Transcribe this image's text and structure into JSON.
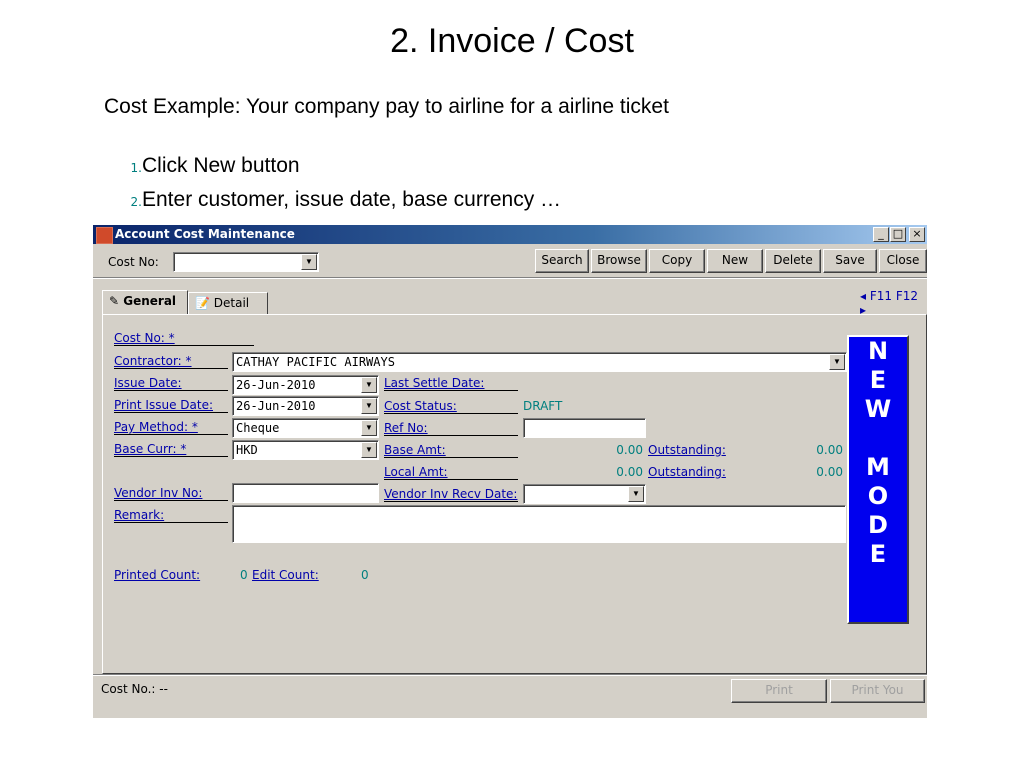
{
  "slide": {
    "title": "2. Invoice / Cost",
    "subtitle": "Cost Example: Your company pay to airline for a airline ticket",
    "steps": [
      {
        "num": "1.",
        "text": "Click New button"
      },
      {
        "num": "2.",
        "text": "Enter customer, issue date, base currency …"
      }
    ]
  },
  "window": {
    "title": "Account Cost Maintenance",
    "controls": {
      "minimize": "_",
      "maximize": "□",
      "close": "×"
    }
  },
  "toolbar": {
    "cost_no_label": "Cost No:",
    "cost_no_value": "",
    "buttons": {
      "search": "Search",
      "browse": "Browse",
      "copy": "Copy",
      "new": "New",
      "delete": "Delete",
      "save": "Save",
      "close": "Close"
    }
  },
  "tabs": {
    "general": "General",
    "detail": "Detail",
    "nav": "◂ F11 F12 ▸"
  },
  "form": {
    "cost_no_label": "Cost No: *",
    "contractor_label": "Contractor: *",
    "contractor_value": "CATHAY PACIFIC AIRWAYS",
    "issue_date_label": "Issue Date:",
    "issue_date_value": "26-Jun-2010",
    "last_settle_date_label": "Last Settle Date:",
    "print_issue_date_label": "Print Issue Date:",
    "print_issue_date_value": "26-Jun-2010",
    "cost_status_label": "Cost Status:",
    "cost_status_value": "DRAFT",
    "pay_method_label": "Pay Method: *",
    "pay_method_value": "Cheque",
    "ref_no_label": "Ref No:",
    "base_curr_label": "Base Curr: *",
    "base_curr_value": "HKD",
    "base_amt_label": "Base Amt:",
    "base_amt_value": "0.00",
    "outstanding_label": "Outstanding:",
    "base_outstanding_value": "0.00",
    "local_amt_label": "Local Amt:",
    "local_amt_value": "0.00",
    "local_outstanding_value": "0.00",
    "vendor_inv_no_label": "Vendor Inv No:",
    "vendor_inv_recv_date_label": "Vendor Inv Recv Date:",
    "remark_label": "Remark:",
    "printed_count_label": "Printed Count:",
    "printed_count_value": "0",
    "edit_count_label": "Edit Count:",
    "edit_count_value": "0"
  },
  "mode_badge": [
    "N",
    "E",
    "W",
    "",
    "M",
    "O",
    "D",
    "E"
  ],
  "status": {
    "cost_no": "Cost No.: --",
    "print_button": "Print",
    "print_you_button": "Print You"
  },
  "colors": {
    "window_bg": "#d4d0c8",
    "title_gradient_start": "#0a246a",
    "link": "#0000aa",
    "value_teal": "#007f7f",
    "mode_badge": "#0000ee"
  }
}
